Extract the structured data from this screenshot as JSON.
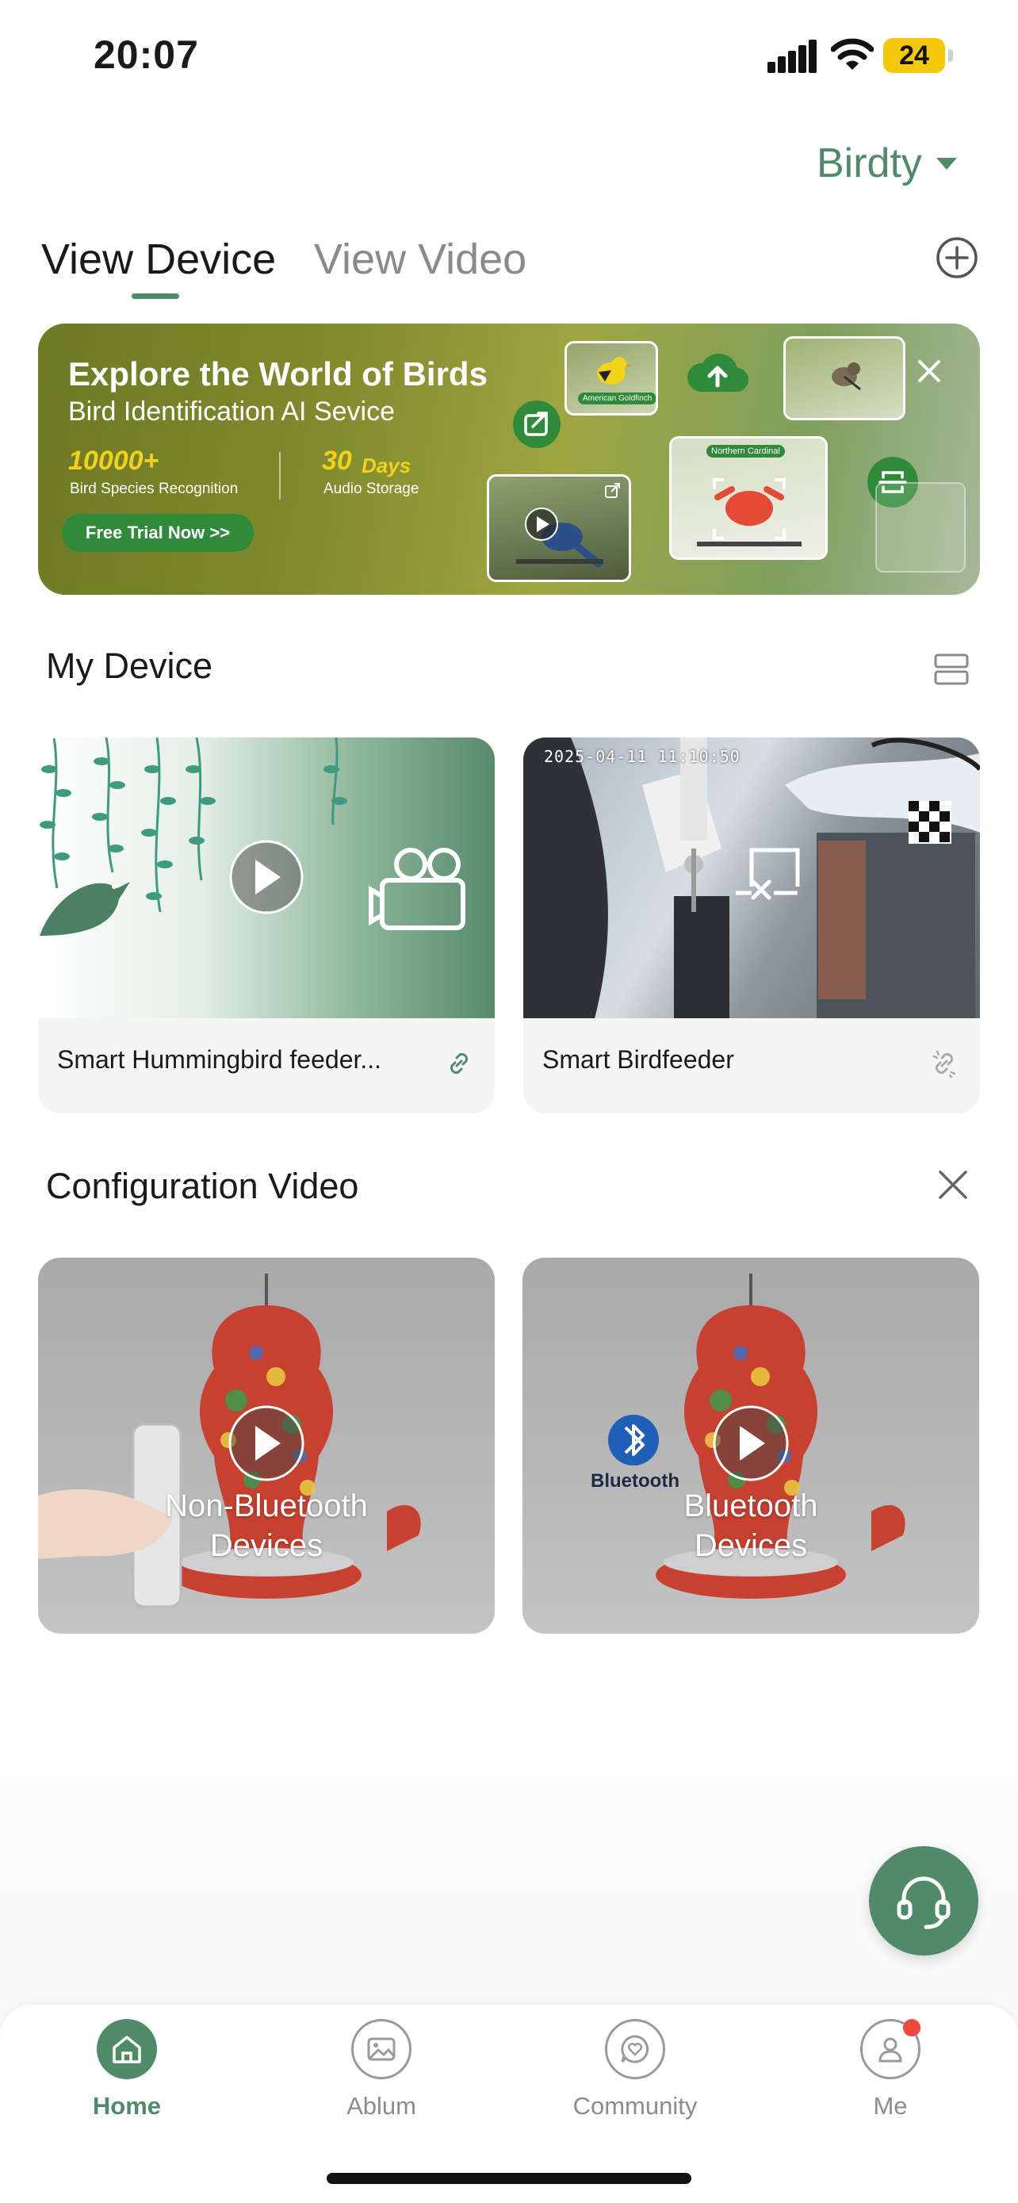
{
  "status_bar": {
    "time": "20:07",
    "battery_level": "24",
    "icons": [
      "signal-icon",
      "wifi-icon",
      "battery-icon"
    ]
  },
  "header": {
    "brand": "Birdty",
    "tabs": [
      {
        "label": "View Device",
        "active": true
      },
      {
        "label": "View Video",
        "active": false
      }
    ],
    "add_icon": "plus-circle-icon"
  },
  "banner": {
    "title": "Explore the World of Birds",
    "subtitle": "Bird Identification AI Sevice",
    "stats": [
      {
        "value": "10000+",
        "unit": "",
        "label": "Bird Species Recognition"
      },
      {
        "value": "30",
        "unit": "Days",
        "label": "Audio Storage"
      }
    ],
    "cta": "Free Trial Now >>",
    "tags": [
      "American Goldfinch",
      "Northern Cardinal"
    ]
  },
  "my_device": {
    "title": "My Device",
    "devices": [
      {
        "name": "Smart Hummingbird feeder...",
        "status_icon": "link-icon"
      },
      {
        "name": "Smart Birdfeeder",
        "status_icon": "link-broken-icon",
        "timestamp": "2025-04-11 11:10:50"
      }
    ]
  },
  "config_video": {
    "title": "Configuration Video",
    "videos": [
      {
        "line1": "Non-Bluetooth",
        "line2": "Devices"
      },
      {
        "line1": "Bluetooth",
        "line2": "Devices",
        "badge": "Bluetooth"
      }
    ]
  },
  "bottom_nav": {
    "items": [
      {
        "label": "Home",
        "icon": "home-icon",
        "active": true
      },
      {
        "label": "Ablum",
        "icon": "album-icon",
        "active": false
      },
      {
        "label": "Community",
        "icon": "community-icon",
        "active": false
      },
      {
        "label": "Me",
        "icon": "profile-icon",
        "active": false,
        "notification": true
      }
    ]
  },
  "colors": {
    "accent": "#4f8a69",
    "battery": "#f5c90b",
    "cta": "#2f8a3a",
    "notification": "#f2463a"
  }
}
